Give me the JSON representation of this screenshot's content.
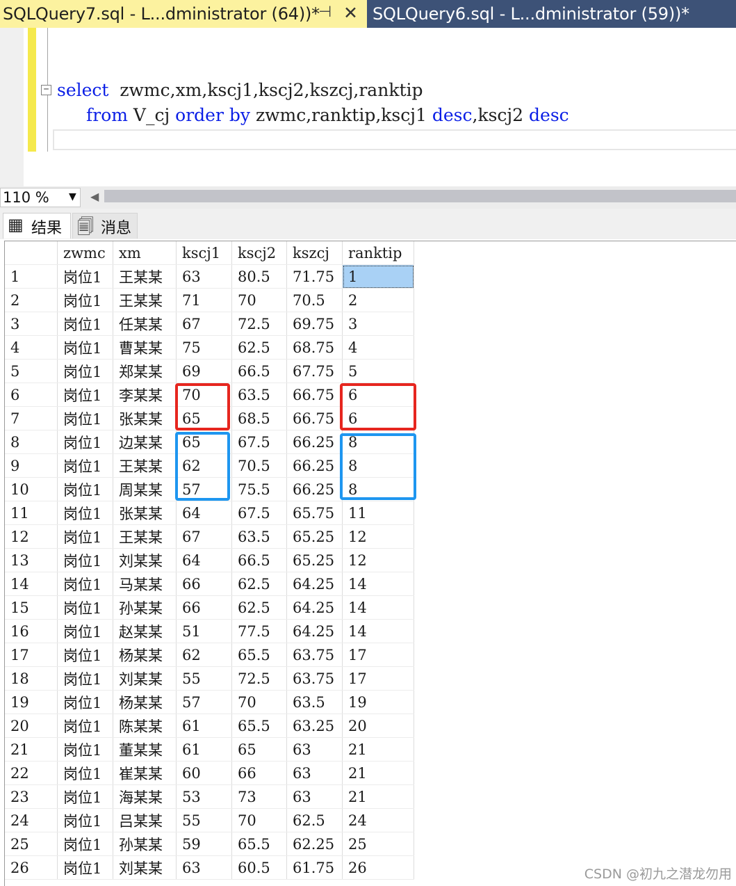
{
  "tabs": {
    "active_title": "SQLQuery7.sql - L...dministrator (64))*",
    "inactive_title": "SQLQuery6.sql - L...dministrator (59))*",
    "pin_glyph": "⊣",
    "close_glyph": "✕"
  },
  "editor": {
    "fold_glyph": "−",
    "line1": {
      "kw_select": "select",
      "rest": "  zwmc,xm,kscj1,kscj2,kszcj,ranktip"
    },
    "line2": {
      "kw_from": "from",
      "t1": " V_cj ",
      "kw_order_by": "order by",
      "t2": " zwmc,ranktip,kscj1 ",
      "kw_desc1": "desc",
      "t3": ",kscj2 ",
      "kw_desc2": "desc"
    }
  },
  "zoom": {
    "value": "110 %",
    "arrow": "▼",
    "scroll_left": "◀"
  },
  "result_tabs": {
    "results": "结果",
    "results_icon": "grid-icon",
    "messages": "消息",
    "messages_icon": "messages-icon"
  },
  "grid": {
    "columns": [
      "",
      "zwmc",
      "xm",
      "kscj1",
      "kscj2",
      "kszcj",
      "ranktip"
    ],
    "rows": [
      [
        "1",
        "岗位1",
        "王某某",
        "63",
        "80.5",
        "71.75",
        "1"
      ],
      [
        "2",
        "岗位1",
        "王某某",
        "71",
        "70",
        "70.5",
        "2"
      ],
      [
        "3",
        "岗位1",
        "任某某",
        "67",
        "72.5",
        "69.75",
        "3"
      ],
      [
        "4",
        "岗位1",
        "曹某某",
        "75",
        "62.5",
        "68.75",
        "4"
      ],
      [
        "5",
        "岗位1",
        "郑某某",
        "69",
        "66.5",
        "67.75",
        "5"
      ],
      [
        "6",
        "岗位1",
        "李某某",
        "70",
        "63.5",
        "66.75",
        "6"
      ],
      [
        "7",
        "岗位1",
        "张某某",
        "65",
        "68.5",
        "66.75",
        "6"
      ],
      [
        "8",
        "岗位1",
        "边某某",
        "65",
        "67.5",
        "66.25",
        "8"
      ],
      [
        "9",
        "岗位1",
        "王某某",
        "62",
        "70.5",
        "66.25",
        "8"
      ],
      [
        "10",
        "岗位1",
        "周某某",
        "57",
        "75.5",
        "66.25",
        "8"
      ],
      [
        "11",
        "岗位1",
        "张某某",
        "64",
        "67.5",
        "65.75",
        "11"
      ],
      [
        "12",
        "岗位1",
        "王某某",
        "67",
        "63.5",
        "65.25",
        "12"
      ],
      [
        "13",
        "岗位1",
        "刘某某",
        "64",
        "66.5",
        "65.25",
        "12"
      ],
      [
        "14",
        "岗位1",
        "马某某",
        "66",
        "62.5",
        "64.25",
        "14"
      ],
      [
        "15",
        "岗位1",
        "孙某某",
        "66",
        "62.5",
        "64.25",
        "14"
      ],
      [
        "16",
        "岗位1",
        "赵某某",
        "51",
        "77.5",
        "64.25",
        "14"
      ],
      [
        "17",
        "岗位1",
        "杨某某",
        "62",
        "65.5",
        "63.75",
        "17"
      ],
      [
        "18",
        "岗位1",
        "刘某某",
        "55",
        "72.5",
        "63.75",
        "17"
      ],
      [
        "19",
        "岗位1",
        "杨某某",
        "57",
        "70",
        "63.5",
        "19"
      ],
      [
        "20",
        "岗位1",
        "陈某某",
        "61",
        "65.5",
        "63.25",
        "20"
      ],
      [
        "21",
        "岗位1",
        "董某某",
        "61",
        "65",
        "63",
        "21"
      ],
      [
        "22",
        "岗位1",
        "崔某某",
        "60",
        "66",
        "63",
        "21"
      ],
      [
        "23",
        "岗位1",
        "海某某",
        "53",
        "73",
        "63",
        "21"
      ],
      [
        "24",
        "岗位1",
        "吕某某",
        "55",
        "70",
        "62.5",
        "24"
      ],
      [
        "25",
        "岗位1",
        "孙某某",
        "59",
        "65.5",
        "62.25",
        "25"
      ],
      [
        "26",
        "岗位1",
        "刘某某",
        "63",
        "60.5",
        "61.75",
        "26"
      ]
    ],
    "selected_cell": {
      "row": 0,
      "col": 6
    }
  },
  "colors": {
    "tab_active_bg": "#fcf29f",
    "tab_inactive_bg": "#3d5277",
    "keyword": "#0a1ee6",
    "highlight_red": "#e6261f",
    "highlight_blue": "#1e96f0",
    "selected_cell": "#a9d1f5"
  },
  "watermark": "CSDN @初九之潜龙勿用"
}
